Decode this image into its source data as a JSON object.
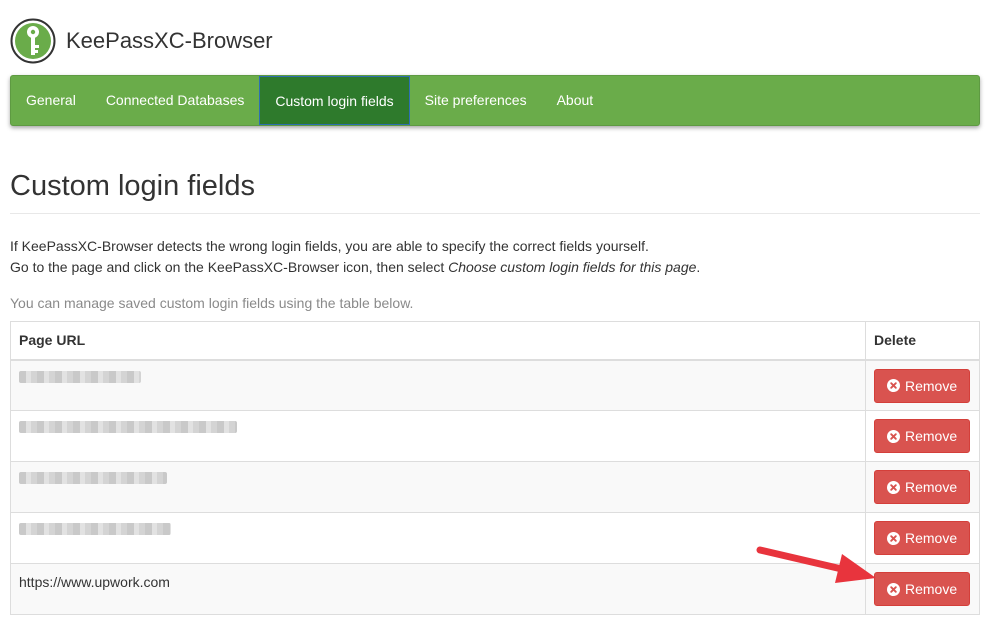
{
  "app": {
    "title": "KeePassXC-Browser",
    "logo_icon": "keepassxc-logo-icon"
  },
  "nav": {
    "items": [
      {
        "label": "General",
        "active": false
      },
      {
        "label": "Connected Databases",
        "active": false
      },
      {
        "label": "Custom login fields",
        "active": true
      },
      {
        "label": "Site preferences",
        "active": false
      },
      {
        "label": "About",
        "active": false
      }
    ]
  },
  "page": {
    "title": "Custom login fields",
    "desc_line1": "If KeePassXC-Browser detects the wrong login fields, you are able to specify the correct fields yourself.",
    "desc_line2_prefix": "Go to the page and click on the KeePassXC-Browser icon, then select ",
    "desc_line2_em": "Choose custom login fields for this page",
    "desc_line2_suffix": ".",
    "manage_note": "You can manage saved custom login fields using the table below."
  },
  "table": {
    "headers": {
      "url": "Page URL",
      "delete": "Delete"
    },
    "remove_label": "Remove",
    "rows": [
      {
        "url": "",
        "blurred": true
      },
      {
        "url": "",
        "blurred": true
      },
      {
        "url": "",
        "blurred": true
      },
      {
        "url": "",
        "blurred": true
      },
      {
        "url": "https://www.upwork.com",
        "blurred": false
      }
    ]
  },
  "colors": {
    "nav_bg": "#6aac4a",
    "nav_active_bg": "#2e7a2c",
    "danger": "#d9534f",
    "annotation_arrow": "#e8343d"
  }
}
